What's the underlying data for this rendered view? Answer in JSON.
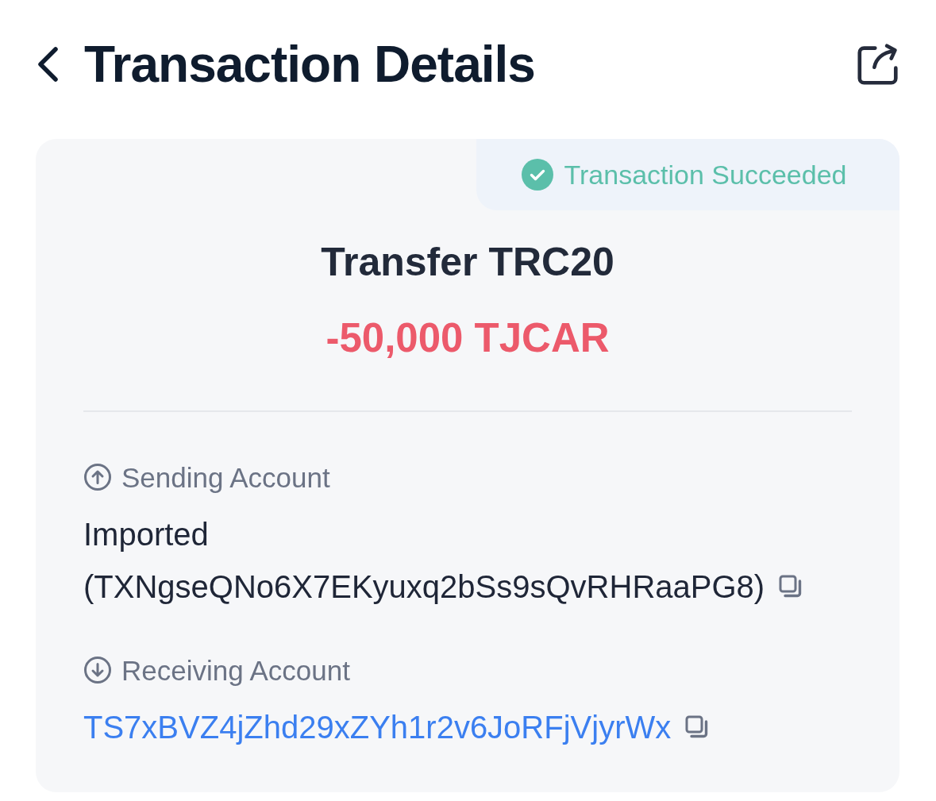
{
  "header": {
    "title": "Transaction Details"
  },
  "card": {
    "status": {
      "label": "Transaction Succeeded",
      "kind": "success"
    },
    "title": "Transfer TRC20",
    "amount": {
      "text": "-50,000 TJCAR",
      "kind": "debit"
    },
    "accounts": [
      {
        "kind": "sending",
        "label": "Sending Account",
        "values": [
          {
            "text": "Imported",
            "kind": "plain",
            "copy": false
          },
          {
            "text": "(TXNgseQNo6X7EKyuxq2bSs9sQvRHRaaPG8)",
            "kind": "plain",
            "copy": true
          }
        ]
      },
      {
        "kind": "receiving",
        "label": "Receiving Account",
        "values": [
          {
            "text": "TS7xBVZ4jZhd29xZYh1r2v6JoRFjVjyrWx",
            "kind": "link",
            "copy": true
          }
        ]
      }
    ]
  }
}
